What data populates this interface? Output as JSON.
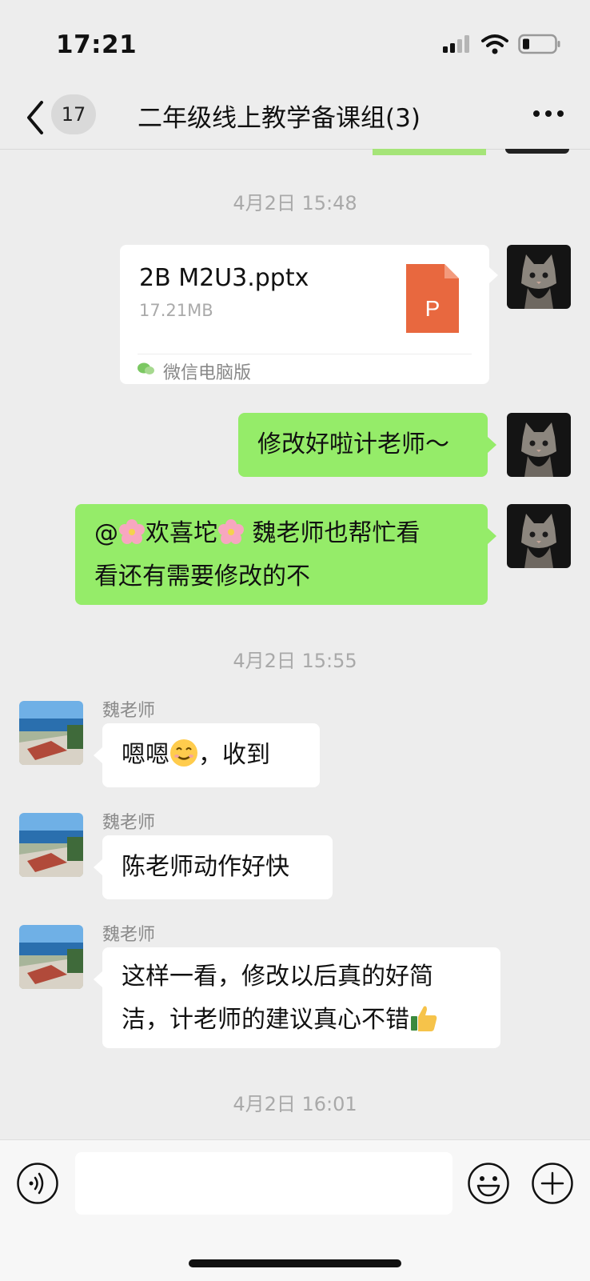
{
  "status": {
    "time": "17:21"
  },
  "header": {
    "unread_count": "17",
    "title": "二年级线上教学备课组(3)"
  },
  "messages": {
    "ts1": "4月2日 15:48",
    "file": {
      "name": "2B M2U3.pptx",
      "size": "17.21MB",
      "source": "微信电脑版",
      "badge": "P"
    },
    "msg2": "修改好啦计老师～",
    "msg3_a": "@",
    "msg3_b": "欢喜坨",
    "msg3_c": " 魏老师也帮忙看",
    "msg3_line2": "看还有需要修改的不",
    "ts2": "4月2日 15:55",
    "sender": "魏老师",
    "reply1_a": "嗯嗯",
    "reply1_b": "，收到",
    "reply2": "陈老师动作好快",
    "reply3_line1": "这样一看，修改以后真的好简",
    "reply3_line2": "洁，计老师的建议真心不错",
    "ts3": "4月2日 16:01"
  },
  "colors": {
    "bubble_green": "#95ec69",
    "background": "#ededed",
    "file_orange": "#e8683f"
  },
  "icons": [
    "back-chevron-icon",
    "more-icon",
    "signal-icon",
    "wifi-icon",
    "battery-icon",
    "voice-icon",
    "emoji-icon",
    "plus-icon",
    "ppt-file-icon",
    "wechat-icon",
    "flower-emoji-icon",
    "smile-emoji-icon",
    "thumbs-up-emoji-icon"
  ]
}
